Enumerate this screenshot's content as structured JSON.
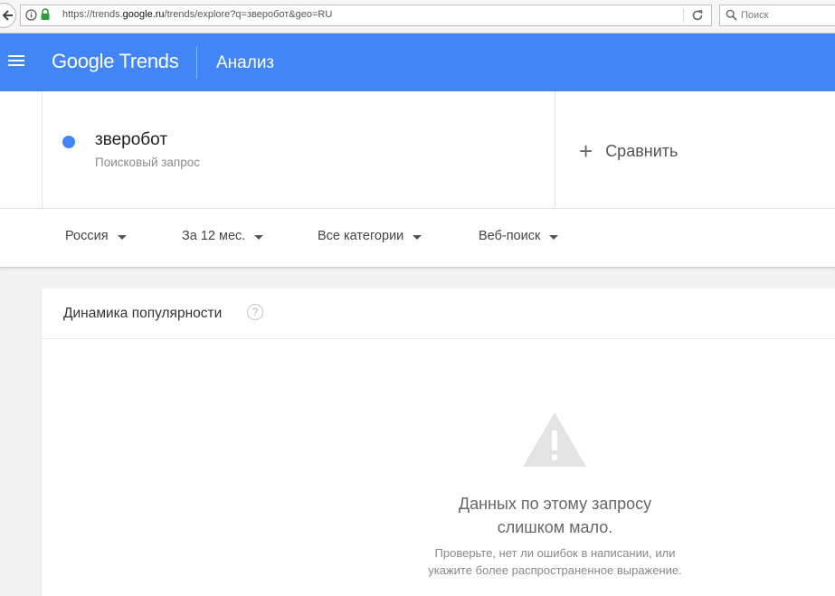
{
  "browser": {
    "url_prefix": "https://trends.",
    "url_domain": "google.ru",
    "url_rest": "/trends/explore?q=зверобот&geo=RU",
    "search_placeholder": "Поиск"
  },
  "header": {
    "brand_google": "Google",
    "brand_trends": "Trends",
    "section": "Анализ",
    "color": "#4285f4"
  },
  "term": {
    "name": "зверобот",
    "type": "Поисковый запрос",
    "color": "#4285f4"
  },
  "compare": {
    "label": "Сравнить"
  },
  "filters": {
    "region": "Россия",
    "period": "За 12 мес.",
    "category": "Все категории",
    "search_type": "Веб-поиск"
  },
  "interest": {
    "title": "Динамика популярности",
    "help": "?",
    "message_line1": "Данных по этому запросу",
    "message_line2": "слишком мало.",
    "hint_line1": "Проверьте, нет ли ошибок в написании, или",
    "hint_line2": "укажите более распространенное выражение."
  }
}
